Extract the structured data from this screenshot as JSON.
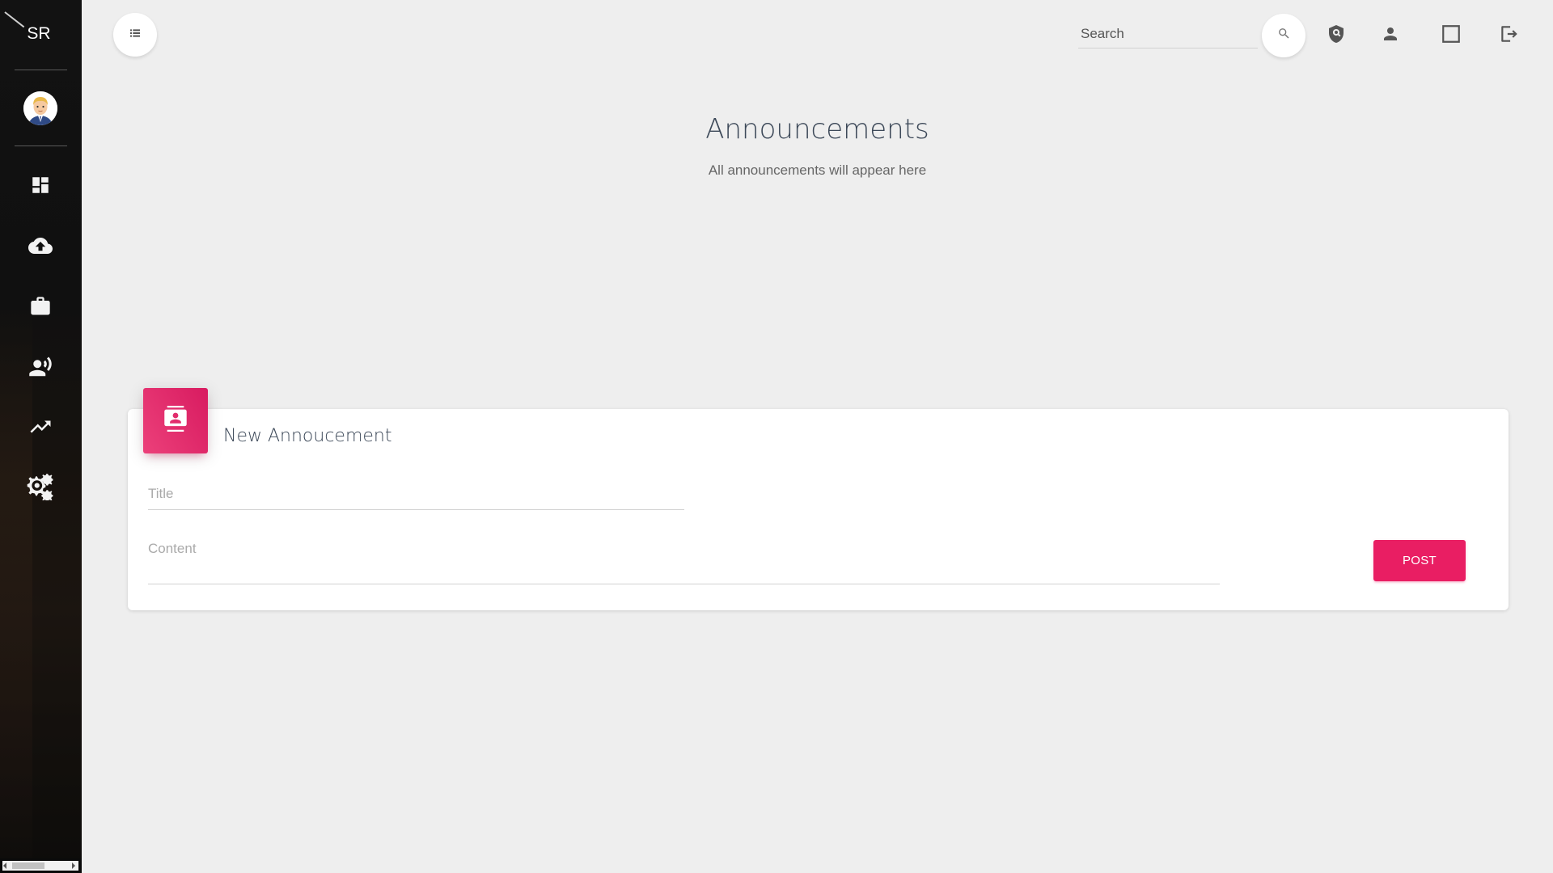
{
  "sidebar": {
    "brand": "SR",
    "items": [
      {
        "name": "dashboard-icon"
      },
      {
        "name": "cloud-upload-icon"
      },
      {
        "name": "briefcase-icon"
      },
      {
        "name": "record-voice-icon"
      },
      {
        "name": "trending-up-icon"
      },
      {
        "name": "settings-gears-icon"
      }
    ]
  },
  "topbar": {
    "search_placeholder": "Search",
    "icons": [
      "menu-icon",
      "search-icon",
      "security-shield-icon",
      "person-icon",
      "fullscreen-icon",
      "logout-icon"
    ]
  },
  "header": {
    "title": "Announcements",
    "subtitle": "All announcements will appear here"
  },
  "card": {
    "title": "New Annoucement",
    "title_placeholder": "Title",
    "content_placeholder": "Content",
    "post_label": "POST",
    "accent_color": "#e91e63"
  }
}
